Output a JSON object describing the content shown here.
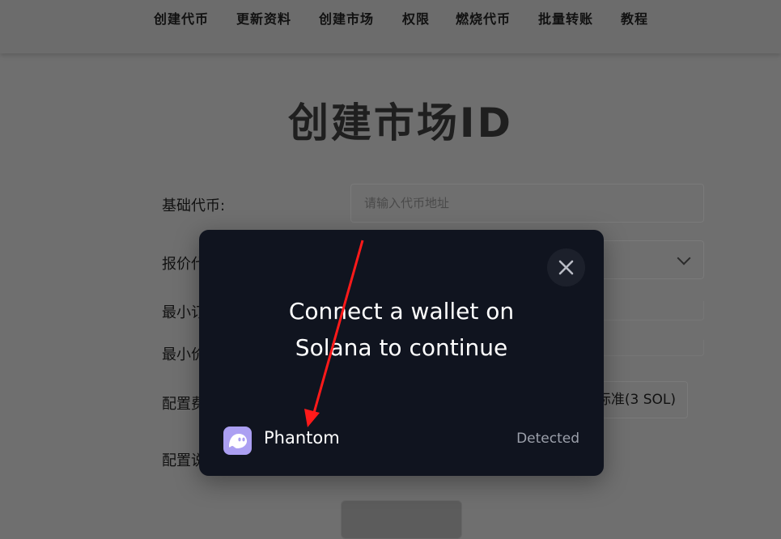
{
  "nav": {
    "items": [
      "创建代币",
      "更新资料",
      "创建市场",
      "权限",
      "燃烧代币",
      "批量转账",
      "教程"
    ]
  },
  "page": {
    "title": "创建市场ID"
  },
  "form": {
    "base_token_label": "基础代币:",
    "base_token_placeholder": "请输入代币地址",
    "quote_label_partial": "报价代",
    "min_order_label_partial": "最小订",
    "min_price_label_partial": "最小价",
    "config_label_partial": "配置费",
    "config2_label_partial": "配置说",
    "fee_option_partial": "标准(3 SOL)"
  },
  "modal": {
    "title_line1": "Connect a wallet on",
    "title_line2": "Solana to continue",
    "wallet_name": "Phantom",
    "wallet_status": "Detected"
  },
  "colors": {
    "modal_bg": "#10141f",
    "phantom_brand": "#ab9ff2",
    "annotation_arrow": "#ff1a1a"
  }
}
